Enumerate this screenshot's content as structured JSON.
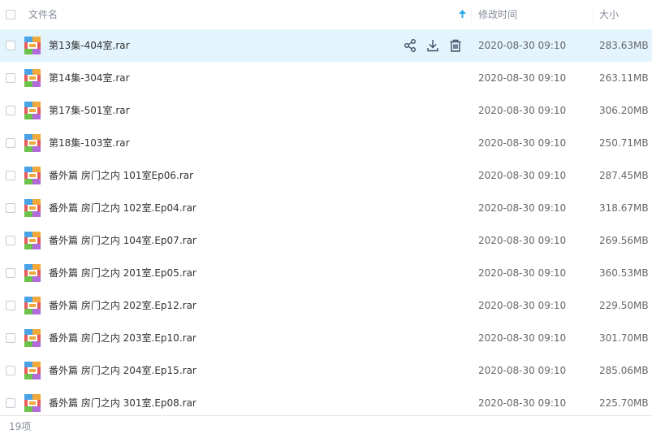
{
  "header": {
    "name_label": "文件名",
    "time_label": "修改时间",
    "size_label": "大小",
    "sort_icon": "sort-up-arrow-icon",
    "accent_color": "#2aa8e6"
  },
  "files": [
    {
      "name": "第13集-404室.rar",
      "time": "2020-08-30 09:10",
      "size": "283.63MB",
      "icon": "rar-archive-icon"
    },
    {
      "name": "第14集-304室.rar",
      "time": "2020-08-30 09:10",
      "size": "263.11MB",
      "icon": "rar-archive-icon"
    },
    {
      "name": "第17集-501室.rar",
      "time": "2020-08-30 09:10",
      "size": "306.20MB",
      "icon": "rar-archive-icon"
    },
    {
      "name": "第18集-103室.rar",
      "time": "2020-08-30 09:10",
      "size": "250.71MB",
      "icon": "rar-archive-icon"
    },
    {
      "name": "番外篇 房门之内 101室Ep06.rar",
      "time": "2020-08-30 09:10",
      "size": "287.45MB",
      "icon": "rar-archive-icon"
    },
    {
      "name": "番外篇 房门之内 102室.Ep04.rar",
      "time": "2020-08-30 09:10",
      "size": "318.67MB",
      "icon": "rar-archive-icon"
    },
    {
      "name": "番外篇 房门之内 104室.Ep07.rar",
      "time": "2020-08-30 09:10",
      "size": "269.56MB",
      "icon": "rar-archive-icon"
    },
    {
      "name": "番外篇 房门之内 201室.Ep05.rar",
      "time": "2020-08-30 09:10",
      "size": "360.53MB",
      "icon": "rar-archive-icon"
    },
    {
      "name": "番外篇 房门之内 202室.Ep12.rar",
      "time": "2020-08-30 09:10",
      "size": "229.50MB",
      "icon": "rar-archive-icon"
    },
    {
      "name": "番外篇 房门之内 203室.Ep10.rar",
      "time": "2020-08-30 09:10",
      "size": "301.70MB",
      "icon": "rar-archive-icon"
    },
    {
      "name": "番外篇 房门之内 204室.Ep15.rar",
      "time": "2020-08-30 09:10",
      "size": "285.06MB",
      "icon": "rar-archive-icon"
    },
    {
      "name": "番外篇 房门之内 301室.Ep08.rar",
      "time": "2020-08-30 09:10",
      "size": "225.70MB",
      "icon": "rar-archive-icon"
    }
  ],
  "row_actions": [
    "share-icon",
    "download-icon",
    "delete-icon"
  ],
  "highlight_color": "#e3f4fd",
  "footer": {
    "count": "19项"
  }
}
